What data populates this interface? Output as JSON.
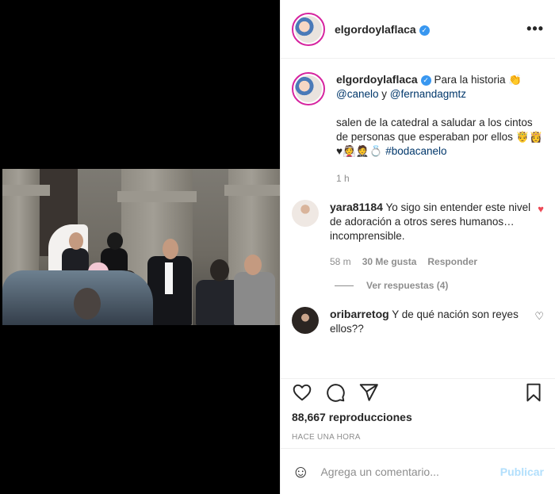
{
  "post": {
    "username": "elgordoylaflaca",
    "verified_icon": "check-icon"
  },
  "caption": {
    "username": "elgordoylaflaca",
    "text1": "Para la historia 👏",
    "mention1": "@canelo",
    "joiner": " y ",
    "mention2": "@fernandagmtz",
    "text2": "salen de la catedral a saludar a los cintos de personas que esperaban por ellos 🤴👸♥👰🤵💍",
    "hashtag": "#bodacanelo",
    "time": "1 h"
  },
  "comments": [
    {
      "username": "yara81184",
      "text": "Yo sigo sin entender este nivel de adoración a otros seres humanos… incomprensible.",
      "time": "58 m",
      "likes": "30 Me gusta",
      "reply": "Responder",
      "view_replies": "Ver respuestas (4)"
    },
    {
      "username": "oribarretog",
      "text": "Y de qué nación son reyes ellos??"
    }
  ],
  "stats": {
    "views": "88,667 reproducciones",
    "posted": "HACE UNA HORA"
  },
  "composer": {
    "placeholder": "Agrega un comentario...",
    "publish": "Publicar"
  },
  "colors": {
    "verified": "#3897f0",
    "like": "#ed4956",
    "link": "#00376b",
    "publish_disabled": "#b2dffc"
  }
}
